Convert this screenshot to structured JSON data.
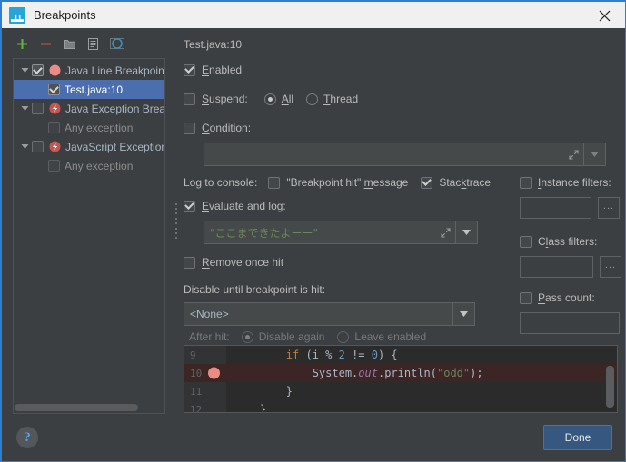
{
  "window": {
    "title": "Breakpoints",
    "app_icon": "intellij-idea-icon",
    "close_icon": "close-icon"
  },
  "toolbar": {
    "add": {
      "name": "add-breakpoint-button",
      "icon": "plus-icon"
    },
    "remove": {
      "name": "remove-breakpoint-button",
      "icon": "minus-icon"
    },
    "group": {
      "name": "group-breakpoints-button",
      "icon": "folder-icon"
    },
    "save": {
      "name": "save-breakpoints-button",
      "icon": "file-icon"
    },
    "mute": {
      "name": "mute-breakpoints-button",
      "icon": "circle-c-icon"
    }
  },
  "tree": {
    "nodes": [
      {
        "label": "Java Line Breakpoints",
        "checked": true,
        "expanded": true,
        "icon": "breakpoint-dot-icon",
        "selected": false,
        "indent": 0,
        "dim": false
      },
      {
        "label": "Test.java:10",
        "checked": true,
        "expanded": null,
        "icon": null,
        "selected": true,
        "indent": 1,
        "dim": false
      },
      {
        "label": "Java Exception Breakpoints",
        "checked": false,
        "expanded": true,
        "icon": "exception-bolt-icon",
        "selected": false,
        "indent": 0,
        "dim": false
      },
      {
        "label": "Any exception",
        "checked": false,
        "expanded": null,
        "icon": null,
        "selected": false,
        "indent": 1,
        "dim": true
      },
      {
        "label": "JavaScript Exception Breakpoints",
        "checked": false,
        "expanded": true,
        "icon": "exception-bolt-icon",
        "selected": false,
        "indent": 0,
        "dim": false
      },
      {
        "label": "Any exception",
        "checked": false,
        "expanded": null,
        "icon": null,
        "selected": false,
        "indent": 1,
        "dim": true
      }
    ],
    "hscroll_name": "tree-horizontal-scrollbar"
  },
  "details": {
    "breakpoint_title": "Test.java:10",
    "enabled": {
      "label": "Enabled",
      "checked": true
    },
    "suspend": {
      "label": "Suspend:",
      "checked": false,
      "options": [
        {
          "label": "All",
          "selected": true
        },
        {
          "label": "Thread",
          "selected": false
        }
      ]
    },
    "condition": {
      "label": "Condition:",
      "checked": false,
      "value": "",
      "expand_icon": "expand-diagonal-icon",
      "dropdown_icon": "chevron-down-icon"
    },
    "log_to_console": {
      "label": "Log to console:",
      "breakpoint_hit_message": {
        "label": "\"Breakpoint hit\" message",
        "checked": false
      },
      "stacktrace": {
        "label": "Stacktrace",
        "checked": true
      }
    },
    "evaluate_and_log": {
      "label": "Evaluate and log:",
      "checked": true,
      "value": "\"ここまできたよーー\"",
      "expand_icon": "expand-diagonal-icon",
      "dropdown_icon": "chevron-down-icon"
    },
    "remove_once_hit": {
      "label": "Remove once hit",
      "checked": false
    },
    "disable_until": {
      "label": "Disable until breakpoint is hit:",
      "value": "<None>",
      "dropdown_icon": "chevron-down-icon"
    },
    "after_hit": {
      "label": "After hit:",
      "options": [
        {
          "label": "Disable again",
          "selected": true
        },
        {
          "label": "Leave enabled",
          "selected": false
        }
      ]
    },
    "instance_filters": {
      "label": "Instance filters:",
      "checked": false,
      "value": "",
      "browse_label": "..."
    },
    "class_filters": {
      "label": "Class filters:",
      "checked": false,
      "value": "",
      "browse_label": "..."
    },
    "pass_count": {
      "label": "Pass count:",
      "checked": false,
      "value": ""
    }
  },
  "code_preview": {
    "lines": [
      {
        "number": "9",
        "highlighted": false,
        "has_breakpoint": false,
        "text": "        if (i % 2 != 0) {"
      },
      {
        "number": "10",
        "highlighted": true,
        "has_breakpoint": true,
        "text": "            System.out.println(\"odd\");"
      },
      {
        "number": "11",
        "highlighted": false,
        "has_breakpoint": false,
        "text": "        }"
      },
      {
        "number": "12",
        "highlighted": false,
        "has_breakpoint": false,
        "text": "    }"
      }
    ],
    "vscroll_name": "code-vertical-scrollbar"
  },
  "footer": {
    "help_label": "?",
    "done_label": "Done"
  },
  "colors": {
    "accent_blue": "#2d7dd2",
    "selection_blue": "#4b6eaf",
    "button_blue": "#365880",
    "panel_bg": "#3c3f41",
    "code_bg": "#2b2b2b",
    "breakpoint_red": "#ea8b86",
    "string_green": "#6a8759",
    "title_bar_bg": "#f0f0f0"
  }
}
